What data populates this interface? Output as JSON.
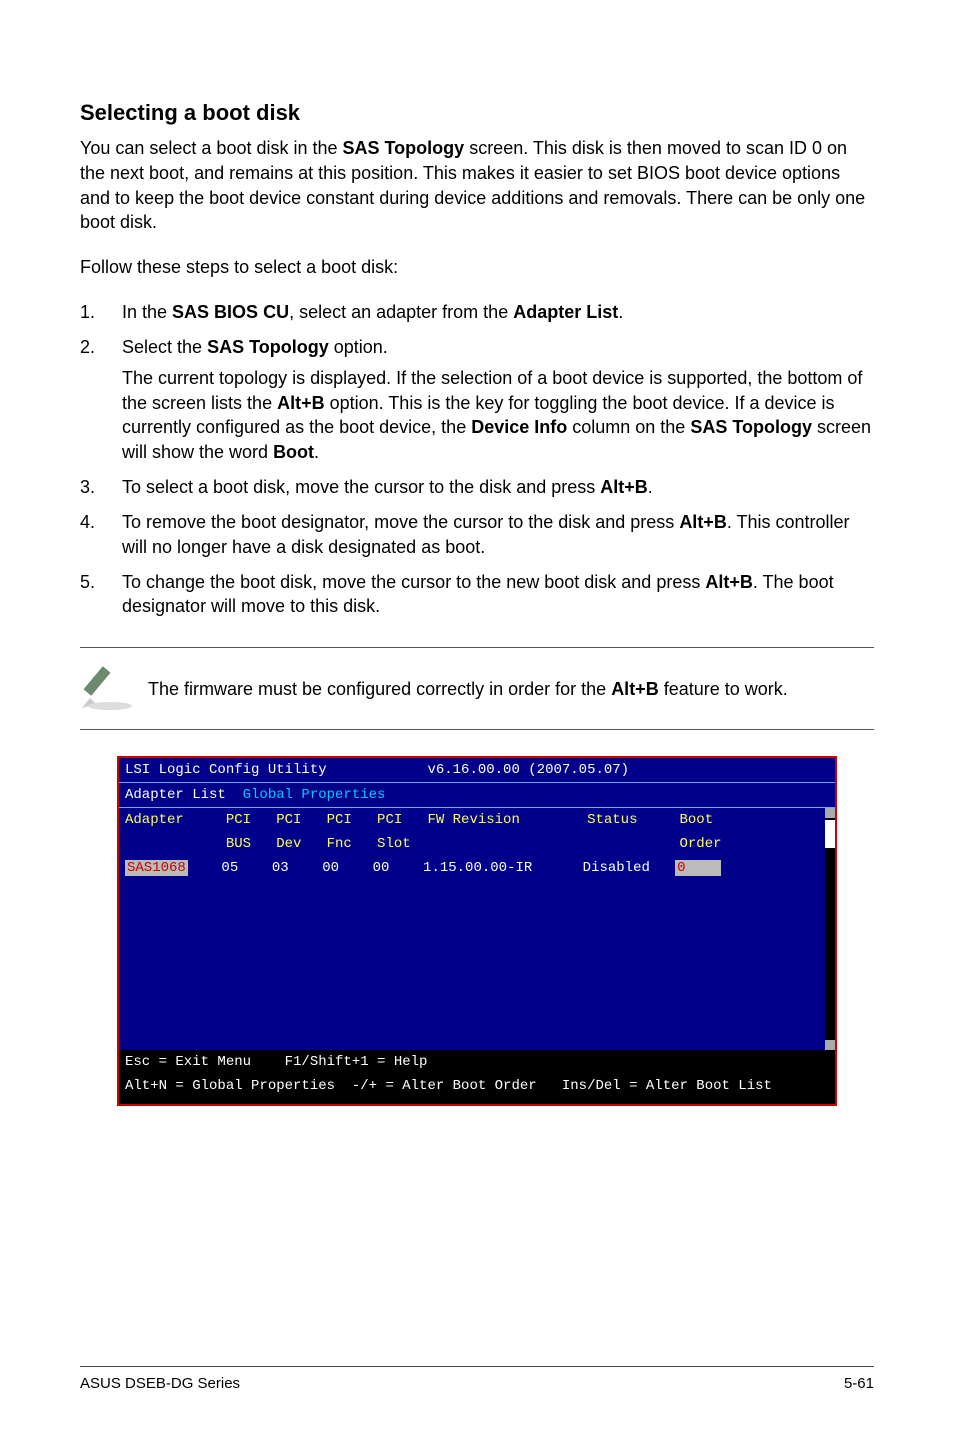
{
  "heading": "Selecting a boot disk",
  "intro_parts": {
    "p1a": "You can select a boot disk in the ",
    "p1b": "SAS Topology",
    "p1c": " screen. This disk is then moved to scan ID 0 on the next boot, and remains at this position. This makes it easier to set BIOS boot device options and to keep the boot device constant during device additions and removals. There can be only one boot disk."
  },
  "follow_text": "Follow these steps to select a boot disk:",
  "steps": [
    {
      "num": "1.",
      "parts": [
        "In the ",
        "SAS BIOS CU",
        ", select an adapter from the ",
        "Adapter List",
        "."
      ]
    },
    {
      "num": "2.",
      "parts": [
        "Select the ",
        "SAS Topology",
        " option."
      ],
      "sub_parts": [
        "The current topology is displayed. If the selection of a boot device is supported, the bottom of the screen lists the ",
        "Alt+B",
        " option. This is the key for toggling the boot device. If a device is currently configured as the boot device, the ",
        "Device Info",
        " column on the ",
        "SAS Topology",
        " screen will show the word ",
        "Boot",
        "."
      ]
    },
    {
      "num": "3.",
      "parts": [
        "To select a boot disk, move the cursor to the disk and press ",
        "Alt+B",
        "."
      ]
    },
    {
      "num": "4.",
      "parts": [
        "To remove the boot designator, move the cursor to the disk and press ",
        "Alt+B",
        ". This controller will no longer have a disk designated as boot."
      ]
    },
    {
      "num": "5.",
      "parts": [
        "To change the boot disk, move the cursor to the new boot disk and press ",
        "Alt+B",
        ". The boot designator will move to this disk."
      ]
    }
  ],
  "note_parts": [
    "The firmware must be configured correctly in order for the ",
    "Alt+B",
    " feature to work."
  ],
  "terminal": {
    "title": "LSI Logic Config Utility            v6.16.00.00 (2007.05.07)",
    "crumb_white": "Adapter List ",
    "crumb_cyan": " Global Properties",
    "hdr1": "Adapter     PCI   PCI   PCI   PCI   FW Revision        Status     Boot ",
    "hdr2": "            BUS   Dev   Fnc   Slot                                Order",
    "row_adapter": "SAS1068",
    "row_mid": "    05    03    00    00    1.15.00.00-IR      Disabled   ",
    "row_bootorder": "0    ",
    "footer1": "Esc = Exit Menu    F1/Shift+1 = Help                                       ",
    "footer2": "Alt+N = Global Properties  -/+ = Alter Boot Order   Ins/Del = Alter Boot List"
  },
  "footer_left": "ASUS DSEB-DG Series",
  "footer_right": "5-61"
}
